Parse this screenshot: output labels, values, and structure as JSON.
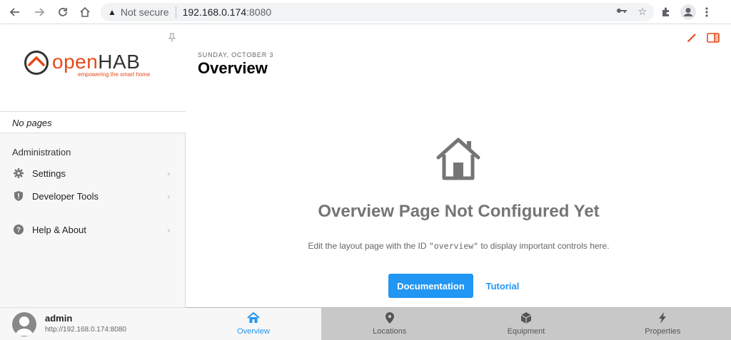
{
  "browser": {
    "security_label": "Not secure",
    "url_host": "192.168.0.174",
    "url_port": ":8080"
  },
  "sidebar": {
    "no_pages": "No pages",
    "section_title": "Administration",
    "items": [
      {
        "label": "Settings",
        "icon": "gear-icon"
      },
      {
        "label": "Developer Tools",
        "icon": "shield-icon"
      },
      {
        "label": "Help & About",
        "icon": "help-icon"
      }
    ],
    "user": {
      "name": "admin",
      "url": "http://192.168.0.174:8080"
    }
  },
  "logo": {
    "name_part1": "open",
    "name_part2": "HAB",
    "tagline": "empowering the smart home"
  },
  "main": {
    "date": "SUNDAY, OCTOBER 3",
    "title": "Overview",
    "empty_title": "Overview Page Not Configured Yet",
    "empty_desc_before": "Edit the layout page with the ID ",
    "empty_desc_code": "\"overview\"",
    "empty_desc_after": " to display important controls here.",
    "doc_button": "Documentation",
    "tutorial_link": "Tutorial"
  },
  "tabs": [
    {
      "label": "Overview",
      "icon": "home-icon",
      "active": true
    },
    {
      "label": "Locations",
      "icon": "map-pin-icon",
      "active": false
    },
    {
      "label": "Equipment",
      "icon": "cube-icon",
      "active": false
    },
    {
      "label": "Properties",
      "icon": "bolt-icon",
      "active": false
    }
  ],
  "colors": {
    "accent": "#2196f3",
    "brand": "#e64a19"
  }
}
